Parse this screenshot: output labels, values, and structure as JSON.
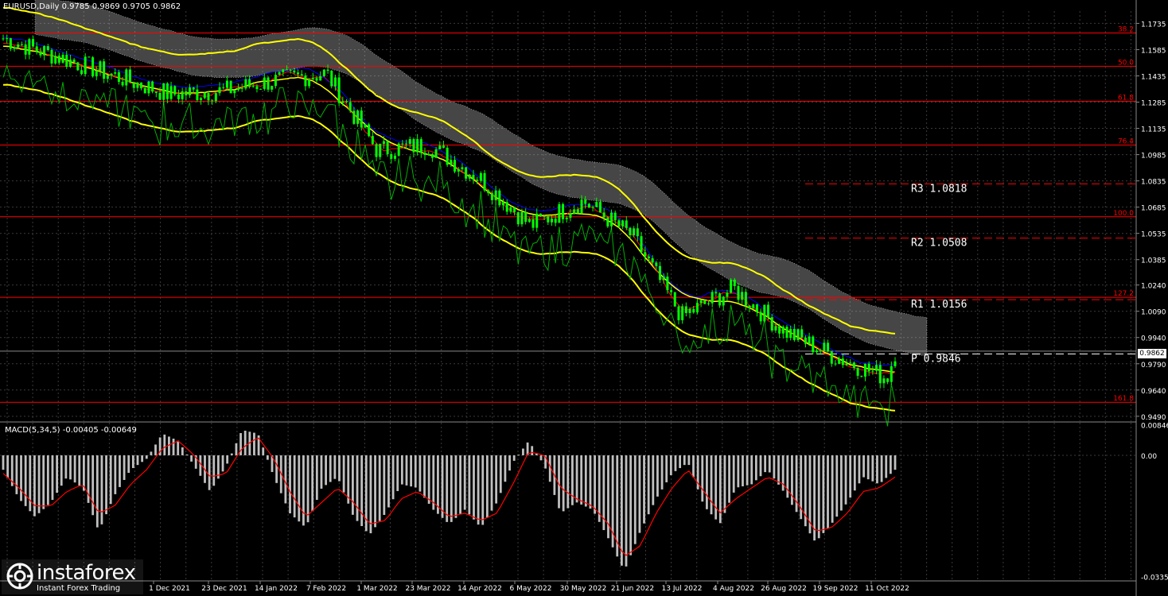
{
  "window_title": "EURUSD,Daily  0.9785 0.9869 0.9705 0.9862",
  "macd_title": "MACD(5,34,5) -0.00405 -0.00649",
  "current_price_label": "0.9862",
  "brand": {
    "name": "instaforex",
    "tagline": "Instant Forex Trading"
  },
  "colors": {
    "background": "#000000",
    "grid": "#3a3a3a",
    "candles": "#00ff00",
    "price_line": "#ffff00",
    "envelope": "#ffff00",
    "lagging_line": "#00b000",
    "fast_ma": "#ff0000",
    "slow_ma": "#0000ff",
    "cloud": "#c8c8c8",
    "fib_level": "#ff0000",
    "pivot_line": "#ffffff",
    "macd_histogram": "#c0c0c0",
    "macd_signal": "#ff0000"
  },
  "chart_data": [
    {
      "type": "line",
      "name": "EURUSD Daily price",
      "x": [
        "1 Dec 2021",
        "23 Dec 2021",
        "14 Jan 2022",
        "7 Feb 2022",
        "1 Mar 2022",
        "23 Mar 2022",
        "14 Apr 2022",
        "6 May 2022",
        "30 May 2022",
        "21 Jun 2022",
        "13 Jul 2022",
        "4 Aug 2022",
        "26 Aug 2022",
        "19 Sep 2022",
        "11 Oct 2022"
      ],
      "x_tick_labels": [
        "1 Dec 2021",
        "23 Dec 2021",
        "14 Jan 2022",
        "7 Feb 2022",
        "1 Mar 2022",
        "23 Mar 2022",
        "14 Apr 2022",
        "6 May 2022",
        "30 May 2022",
        "21 Jun 2022",
        "13 Jul 2022",
        "4 Aug 2022",
        "26 Aug 2022",
        "19 Sep 2022",
        "11 Oct 2022"
      ],
      "y_tick_labels": [
        "1.1735",
        "1.1585",
        "1.1435",
        "1.1285",
        "1.1135",
        "1.0985",
        "1.0835",
        "1.0685",
        "1.0535",
        "1.0385",
        "1.0240",
        "1.0090",
        "0.9940",
        "0.9790",
        "0.9640",
        "0.9490"
      ],
      "y_ticks": [
        1.1735,
        1.1585,
        1.1435,
        1.1285,
        1.1135,
        1.0985,
        1.0835,
        1.0685,
        1.0535,
        1.0385,
        1.024,
        1.009,
        0.994,
        0.979,
        0.964,
        0.949
      ],
      "ylim": [
        0.9462,
        1.1805
      ],
      "series": [
        {
          "name": "Close",
          "values": [
            1.133,
            1.135,
            1.141,
            1.145,
            1.101,
            1.104,
            1.085,
            1.058,
            1.072,
            1.052,
            1.006,
            1.022,
            0.998,
            0.983,
            0.971
          ]
        }
      ],
      "fib_levels": [
        {
          "label": "38.2",
          "value": 1.168
        },
        {
          "label": "50.0",
          "value": 1.149
        },
        {
          "label": "61.8",
          "value": 1.129
        },
        {
          "label": "76.4",
          "value": 1.104
        },
        {
          "label": "100.0",
          "value": 1.063
        },
        {
          "label": "127.2",
          "value": 1.017
        },
        {
          "label": "161.8",
          "value": 0.957
        }
      ],
      "pivot_levels": [
        {
          "label": "R3  1.0818",
          "value": 1.0818
        },
        {
          "label": "R2  1.0508",
          "value": 1.0508
        },
        {
          "label": "R1  1.0156",
          "value": 1.0156
        },
        {
          "label": "P  0.9846",
          "value": 0.9846
        }
      ],
      "current_price": 0.9862
    },
    {
      "type": "bar",
      "name": "MACD(5,34,5)",
      "y_tick_labels": [
        "0.00846",
        "0.00",
        "-0.0335"
      ],
      "y_ticks": [
        0.00846,
        0.0,
        -0.0335
      ],
      "ylim": [
        -0.0345,
        0.009
      ],
      "series": [
        {
          "name": "Main",
          "values": [
            -0.004,
            -0.012,
            -0.017,
            -0.013,
            -0.006,
            -0.009,
            -0.021,
            -0.011,
            -0.004,
            -0.001,
            0.006,
            0.004,
            -0.003,
            -0.01,
            -0.003,
            0.007,
            0.006,
            -0.006,
            -0.016,
            -0.02,
            -0.009,
            -0.006,
            -0.017,
            -0.022,
            -0.016,
            -0.008,
            -0.009,
            -0.015,
            -0.019,
            -0.015,
            -0.02,
            -0.013,
            -0.002,
            0.004,
            -0.003,
            -0.016,
            -0.013,
            -0.015,
            -0.023,
            -0.032,
            -0.021,
            -0.012,
            -0.005,
            -0.002,
            -0.014,
            -0.019,
            -0.009,
            -0.008,
            -0.004,
            -0.01,
            -0.017,
            -0.024,
            -0.019,
            -0.013,
            -0.006,
            -0.008,
            -0.004
          ]
        },
        {
          "name": "Signal",
          "values": [
            -0.005,
            -0.009,
            -0.014,
            -0.014,
            -0.01,
            -0.008,
            -0.016,
            -0.014,
            -0.008,
            -0.004,
            0.002,
            0.004,
            0.0,
            -0.006,
            -0.005,
            0.002,
            0.005,
            -0.001,
            -0.01,
            -0.017,
            -0.013,
            -0.009,
            -0.013,
            -0.019,
            -0.018,
            -0.012,
            -0.01,
            -0.013,
            -0.017,
            -0.016,
            -0.018,
            -0.016,
            -0.008,
            0.001,
            0.0,
            -0.009,
            -0.012,
            -0.014,
            -0.019,
            -0.028,
            -0.025,
            -0.016,
            -0.009,
            -0.004,
            -0.01,
            -0.016,
            -0.012,
            -0.009,
            -0.006,
            -0.008,
            -0.014,
            -0.021,
            -0.02,
            -0.016,
            -0.01,
            -0.009,
            -0.006
          ]
        }
      ]
    }
  ]
}
